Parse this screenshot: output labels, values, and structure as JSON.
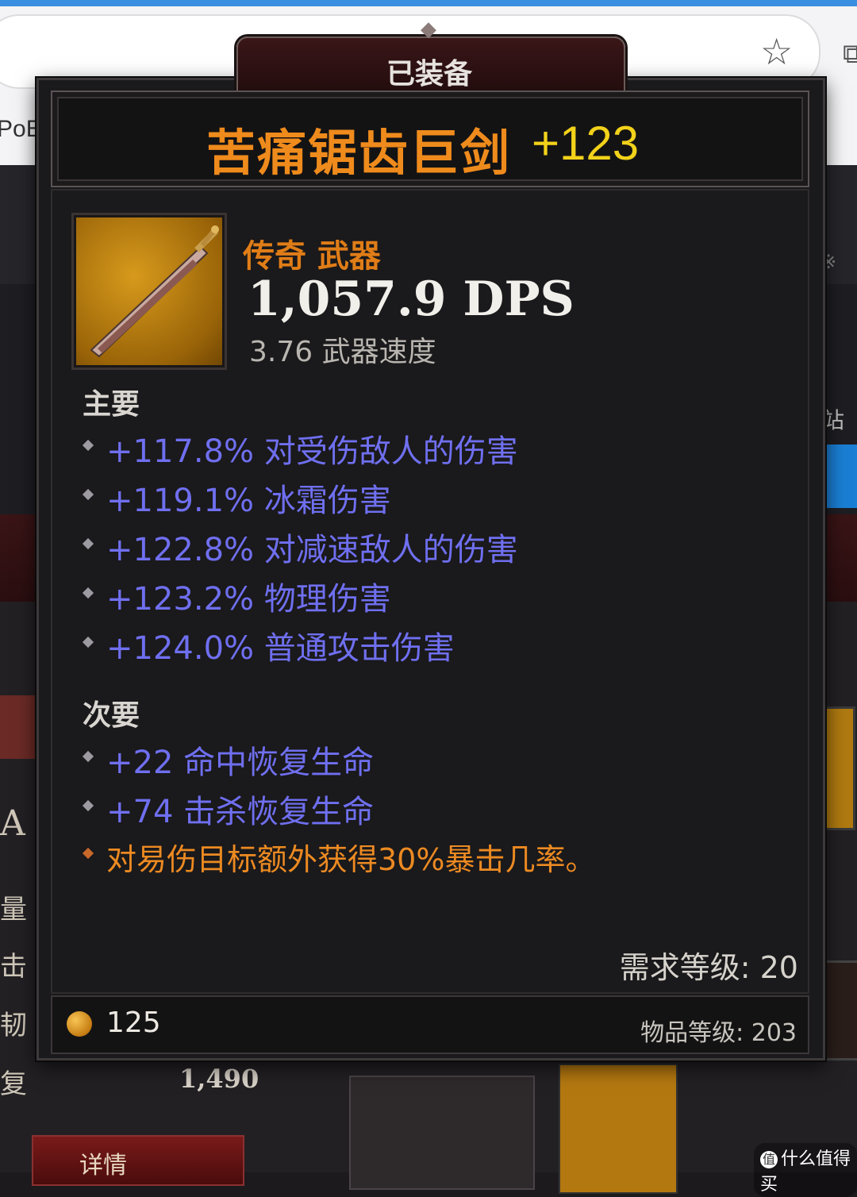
{
  "browser": {
    "tab_fragment": "PoE",
    "star_icon": "star-icon",
    "extension_icon": "puzzle-icon"
  },
  "background": {
    "right_fragment_1": "※",
    "right_fragment_2": "站",
    "left_letter": "A",
    "left_labels": [
      "量",
      "击",
      "韧",
      "复"
    ],
    "hp_value": "1,490",
    "button_label": "详情",
    "watermark": "什么值得买",
    "watermark_icon": "值"
  },
  "tooltip": {
    "equipped_label": "已装备",
    "item_name": "苦痛锯齿巨剑",
    "item_bonus": "+123",
    "item_type": "传奇 武器",
    "dps": "1,057.9 DPS",
    "attack_speed": "3.76 武器速度",
    "primary_heading": "主要",
    "primary_affixes": [
      "+117.8% 对受伤敌人的伤害",
      "+119.1% 冰霜伤害",
      "+122.8% 对减速敌人的伤害",
      "+123.2% 物理伤害",
      "+124.0% 普通攻击伤害"
    ],
    "secondary_heading": "次要",
    "secondary_affixes": [
      "+22 命中恢复生命",
      "+74 击杀恢复生命"
    ],
    "legendary_affix": "对易伤目标额外获得30%暴击几率。",
    "required_level": "需求等级: 20",
    "sell_value": "125",
    "item_power": "物品等级: 203"
  },
  "colors": {
    "legendary_orange": "#ef8b1c",
    "bonus_yellow": "#f2d21a",
    "affix_blue": "#6f6ff0",
    "legendary_affix_orange": "#ec8a22"
  }
}
